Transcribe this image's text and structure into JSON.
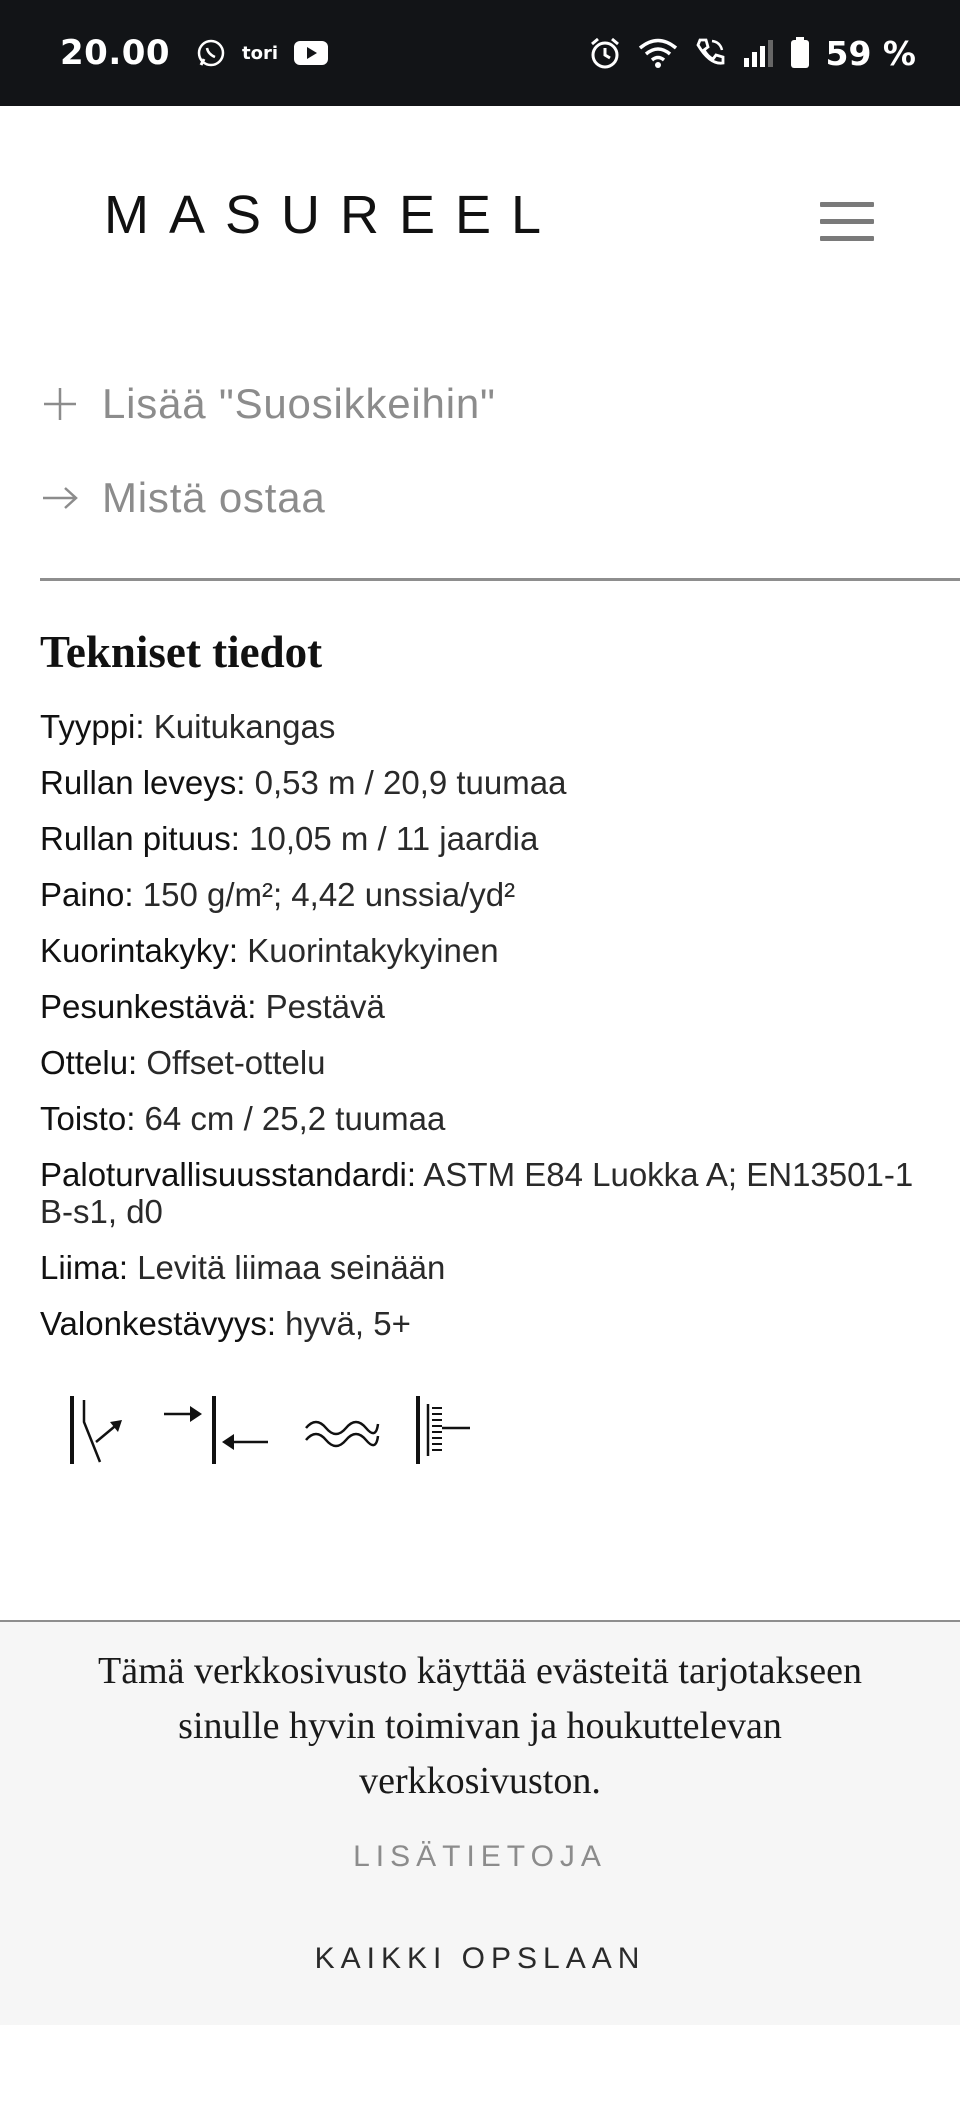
{
  "status_bar": {
    "time": "20.00",
    "notification_app": "tori",
    "battery": "59 %",
    "icons": [
      "whatsapp-icon",
      "youtube-icon",
      "alarm-icon",
      "wifi-icon",
      "call-icon",
      "signal-icon",
      "battery-icon"
    ]
  },
  "header": {
    "logo": "MASUREEL",
    "menu_icon": "hamburger-menu-icon"
  },
  "actions": {
    "favorite_label": "Lisää \"Suosikkeihin\"",
    "where_to_buy_label": "Mistä ostaa"
  },
  "specs": {
    "title": "Tekniset tiedot",
    "items": [
      {
        "key": "Tyyppi:",
        "value": " Kuitukangas"
      },
      {
        "key": "Rullan leveys:",
        "value": " 0,53 m / 20,9 tuumaa"
      },
      {
        "key": "Rullan pituus:",
        "value": " 10,05 m / 11 jaardia"
      },
      {
        "key": "Paino:",
        "value": " 150 g/m²; 4,42 unssia/yd²"
      },
      {
        "key": "Kuorintakyky:",
        "value": " Kuorintakykyinen"
      },
      {
        "key": "Pesunkestävä:",
        "value": " Pestävä"
      },
      {
        "key": "Ottelu:",
        "value": " Offset-ottelu"
      },
      {
        "key": "Toisto:",
        "value": " 64 cm / 25,2 tuumaa"
      },
      {
        "key": "Paloturvallisuusstandardi:",
        "value": " ASTM E84 Luokka A; EN13501-1 B-s1, d0"
      },
      {
        "key": "Liima:",
        "value": " Levitä liimaa seinään"
      },
      {
        "key": "Valonkestävyys:",
        "value": " hyvä, 5+"
      }
    ],
    "care_icons": [
      "peelable-icon",
      "paste-the-wall-icon",
      "washable-icon",
      "offset-match-icon"
    ]
  },
  "cookie": {
    "text": "Tämä verkkosivusto käyttää evästeitä tarjotakseen sinulle hyvin toimivan ja houkuttelevan verkkosivuston.",
    "more_label": "LISÄTIETOJA",
    "accept_label": "KAIKKI OPSLAAN"
  }
}
